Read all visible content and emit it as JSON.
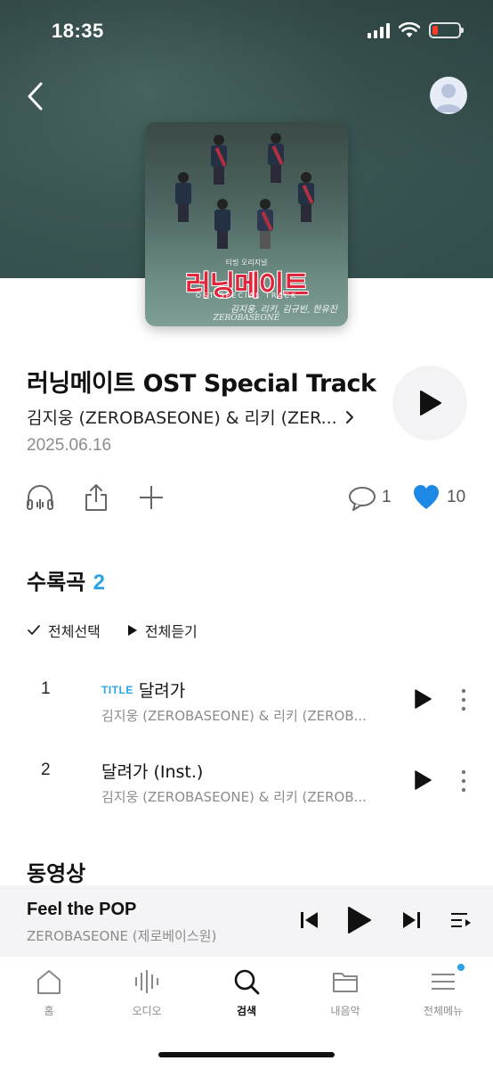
{
  "status_bar": {
    "time": "18:35"
  },
  "album": {
    "art": {
      "logo_text": "러닝메이트",
      "top_small_text": "티빙 오리지널",
      "subtitle": "OST SPECIAL TRACK",
      "names": "김지웅, 리키, 김규빈, 한유진",
      "group": "ZEROBASEONE"
    },
    "title": "러닝메이트 OST Special Track",
    "artist": "김지웅 (ZEROBASEONE) & 리키 (ZER...",
    "release_date": "2025.06.16"
  },
  "actions": {
    "comment_count": "1",
    "like_count": "10"
  },
  "tracklist": {
    "heading": "수록곡",
    "count": "2",
    "select_all": "전체선택",
    "play_all": "전체듣기",
    "tracks": [
      {
        "number": "1",
        "badge": "TITLE",
        "title": "달려가",
        "artist": "김지웅 (ZEROBASEONE) & 리키 (ZEROB..."
      },
      {
        "number": "2",
        "badge": "",
        "title": "달려가 (Inst.)",
        "artist": "김지웅 (ZEROBASEONE) & 리키 (ZEROB..."
      }
    ]
  },
  "videos": {
    "heading": "동영상"
  },
  "mini_player": {
    "title": "Feel the POP",
    "artist": "ZEROBASEONE (제로베이스원)"
  },
  "bottom_nav": {
    "items": [
      {
        "label": "홈",
        "icon": "home-icon"
      },
      {
        "label": "오디오",
        "icon": "audio-wave-icon"
      },
      {
        "label": "검색",
        "icon": "search-icon"
      },
      {
        "label": "내음악",
        "icon": "folder-icon"
      },
      {
        "label": "전체메뉴",
        "icon": "menu-icon"
      }
    ],
    "active_index": 2
  },
  "colors": {
    "accent": "#2aa3e8",
    "heart": "#1e88e5",
    "battery_low": "#ff3b30"
  }
}
